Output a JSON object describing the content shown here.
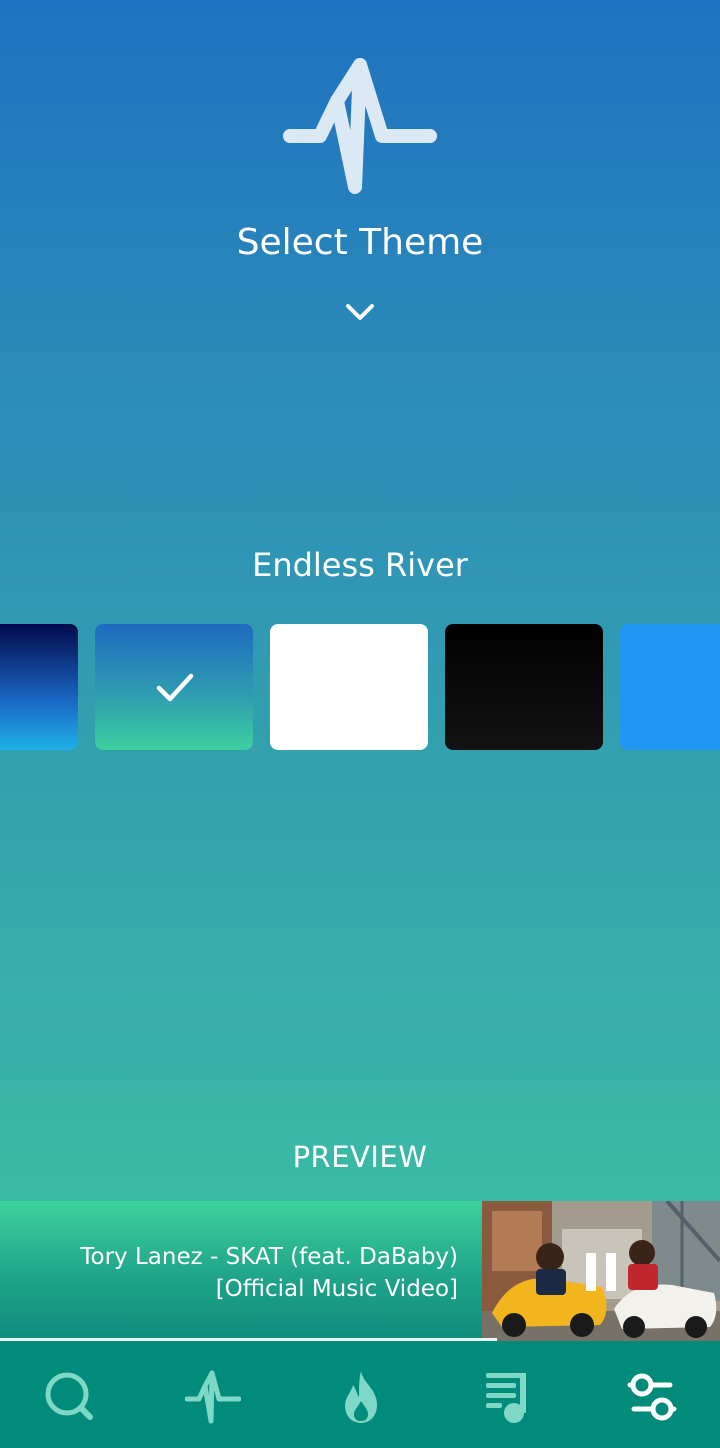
{
  "header": {
    "logo_icon": "pulse-waveform-icon",
    "title": "Select Theme",
    "expand_icon": "chevron-down-icon"
  },
  "theme_picker": {
    "selected_theme_name": "Endless River",
    "swatches": [
      {
        "colors": [
          "#020a4a",
          "#1fb0e6"
        ],
        "selected": false
      },
      {
        "colors": [
          "#1f6ac0",
          "#3dcf9e"
        ],
        "selected": true
      },
      {
        "colors": [
          "#ffffff"
        ],
        "selected": false
      },
      {
        "colors": [
          "#000000",
          "#131313"
        ],
        "selected": false
      },
      {
        "colors": [
          "#2196f3"
        ],
        "selected": false
      }
    ],
    "selected_icon": "checkmark-icon"
  },
  "preview": {
    "label": "PREVIEW",
    "track_title_line1": "Tory Lanez - SKAT (feat. DaBaby)",
    "track_title_line2": "[Official Music Video]",
    "pause_icon": "pause-icon",
    "progress_fraction": 0.69
  },
  "bottom_nav": {
    "items": [
      {
        "icon": "search-icon",
        "active": false
      },
      {
        "icon": "pulse-icon",
        "active": false
      },
      {
        "icon": "flame-icon",
        "active": false
      },
      {
        "icon": "playlist-icon",
        "active": false
      },
      {
        "icon": "settings-sliders-icon",
        "active": true
      }
    ],
    "inactive_color": "#7fd8c6",
    "active_color": "#ffffff"
  },
  "colors": {
    "background_top": "#1f72c1",
    "background_bottom": "#40c9a0",
    "nav_background": "#008b7a"
  }
}
